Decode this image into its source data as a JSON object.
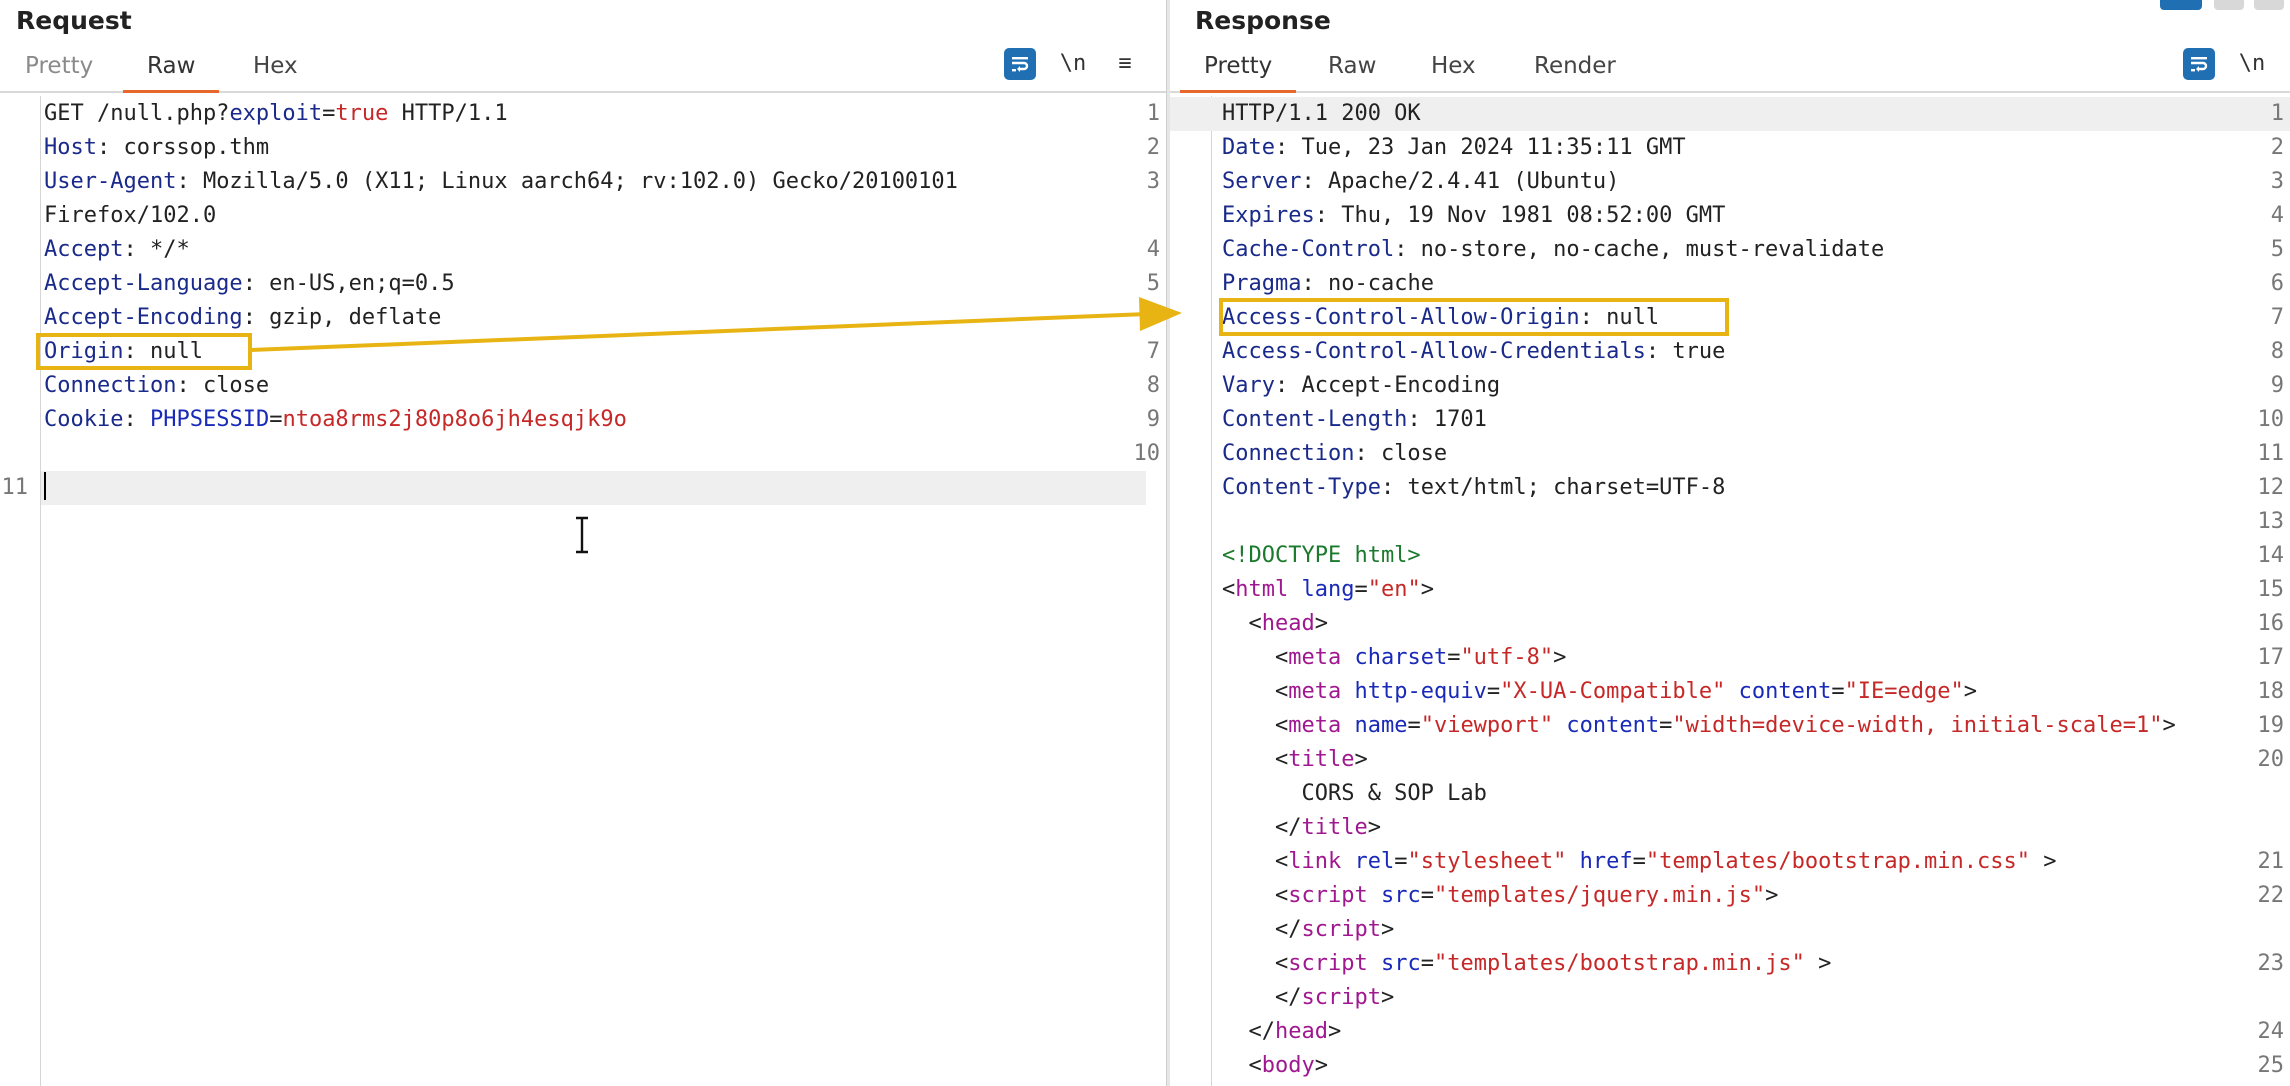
{
  "request": {
    "title": "Request",
    "tabs": [
      {
        "label": "Pretty",
        "active": false
      },
      {
        "label": "Raw",
        "active": true
      },
      {
        "label": "Hex",
        "active": false
      }
    ],
    "newline_btn": "\\n",
    "menu_btn": "≡",
    "lines": [
      {
        "n": "1",
        "t": [
          [
            "GET /null.php?",
            "v"
          ],
          [
            "exploit",
            "k"
          ],
          [
            "=",
            "v"
          ],
          [
            "true",
            "r"
          ],
          [
            " HTTP/1.1",
            "v"
          ]
        ]
      },
      {
        "n": "2",
        "t": [
          [
            "Host",
            "k"
          ],
          [
            ": corssop.thm",
            "v"
          ]
        ]
      },
      {
        "n": "3",
        "t": [
          [
            "User-Agent",
            "k"
          ],
          [
            ": Mozilla/5.0 (X11; Linux aarch64; rv:102.0) Gecko/20100101",
            "v"
          ]
        ]
      },
      {
        "n": "",
        "t": [
          [
            "Firefox/102.0",
            "v"
          ]
        ]
      },
      {
        "n": "4",
        "t": [
          [
            "Accept",
            "k"
          ],
          [
            ": */*",
            "v"
          ]
        ]
      },
      {
        "n": "5",
        "t": [
          [
            "Accept-Language",
            "k"
          ],
          [
            ": en-US,en;q=0.5",
            "v"
          ]
        ]
      },
      {
        "n": "6",
        "t": [
          [
            "Accept-Encoding",
            "k"
          ],
          [
            ": gzip, deflate",
            "v"
          ]
        ]
      },
      {
        "n": "7",
        "t": [
          [
            "Origin",
            "k"
          ],
          [
            ": null",
            "v"
          ]
        ]
      },
      {
        "n": "8",
        "t": [
          [
            "Connection",
            "k"
          ],
          [
            ": close",
            "v"
          ]
        ]
      },
      {
        "n": "9",
        "t": [
          [
            "Cookie",
            "k"
          ],
          [
            ": ",
            "v"
          ],
          [
            "PHPSESSID",
            "b"
          ],
          [
            "=",
            "v"
          ],
          [
            "ntoa8rms2j80p8o6jh4esqjk9o",
            "r"
          ]
        ]
      },
      {
        "n": "10",
        "t": []
      },
      {
        "n": "11",
        "t": [],
        "highlight": true
      }
    ]
  },
  "response": {
    "title": "Response",
    "tabs": [
      {
        "label": "Pretty",
        "active": true
      },
      {
        "label": "Raw",
        "active": false
      },
      {
        "label": "Hex",
        "active": false
      },
      {
        "label": "Render",
        "active": false
      }
    ],
    "newline_btn": "\\n",
    "lines": [
      {
        "n": "1",
        "t": [
          [
            "HTTP/1.1 200 OK",
            "v"
          ]
        ],
        "highlight": true
      },
      {
        "n": "2",
        "t": [
          [
            "Date",
            "k"
          ],
          [
            ": Tue, 23 Jan 2024 11:35:11 GMT",
            "v"
          ]
        ]
      },
      {
        "n": "3",
        "t": [
          [
            "Server",
            "k"
          ],
          [
            ": Apache/2.4.41 (Ubuntu)",
            "v"
          ]
        ]
      },
      {
        "n": "4",
        "t": [
          [
            "Expires",
            "k"
          ],
          [
            ": Thu, 19 Nov 1981 08:52:00 GMT",
            "v"
          ]
        ]
      },
      {
        "n": "5",
        "t": [
          [
            "Cache-Control",
            "k"
          ],
          [
            ": no-store, no-cache, must-revalidate",
            "v"
          ]
        ]
      },
      {
        "n": "6",
        "t": [
          [
            "Pragma",
            "k"
          ],
          [
            ": no-cache",
            "v"
          ]
        ]
      },
      {
        "n": "7",
        "t": [
          [
            "Access-Control-Allow-Origin",
            "k"
          ],
          [
            ": null",
            "v"
          ]
        ]
      },
      {
        "n": "8",
        "t": [
          [
            "Access-Control-Allow-Credentials",
            "k"
          ],
          [
            ": true",
            "v"
          ]
        ]
      },
      {
        "n": "9",
        "t": [
          [
            "Vary",
            "k"
          ],
          [
            ": Accept-Encoding",
            "v"
          ]
        ]
      },
      {
        "n": "10",
        "t": [
          [
            "Content-Length",
            "k"
          ],
          [
            ": 1701",
            "v"
          ]
        ]
      },
      {
        "n": "11",
        "t": [
          [
            "Connection",
            "k"
          ],
          [
            ": close",
            "v"
          ]
        ]
      },
      {
        "n": "12",
        "t": [
          [
            "Content-Type",
            "k"
          ],
          [
            ": text/html; charset=UTF-8",
            "v"
          ]
        ]
      },
      {
        "n": "13",
        "t": []
      },
      {
        "n": "14",
        "t": [
          [
            "<!DOCTYPE html>",
            "g"
          ]
        ]
      },
      {
        "n": "15",
        "t": [
          [
            "<",
            "p"
          ],
          [
            "html",
            "m"
          ],
          [
            " ",
            "p"
          ],
          [
            "lang",
            "b"
          ],
          [
            "=",
            "p"
          ],
          [
            "\"en\"",
            "r"
          ],
          [
            ">",
            "p"
          ]
        ]
      },
      {
        "n": "16",
        "t": [
          [
            "  <",
            "p"
          ],
          [
            "head",
            "m"
          ],
          [
            ">",
            "p"
          ]
        ]
      },
      {
        "n": "17",
        "t": [
          [
            "    <",
            "p"
          ],
          [
            "meta",
            "m"
          ],
          [
            " ",
            "p"
          ],
          [
            "charset",
            "b"
          ],
          [
            "=",
            "p"
          ],
          [
            "\"utf-8\"",
            "r"
          ],
          [
            ">",
            "p"
          ]
        ]
      },
      {
        "n": "18",
        "t": [
          [
            "    <",
            "p"
          ],
          [
            "meta",
            "m"
          ],
          [
            " ",
            "p"
          ],
          [
            "http-equiv",
            "b"
          ],
          [
            "=",
            "p"
          ],
          [
            "\"X-UA-Compatible\"",
            "r"
          ],
          [
            " ",
            "p"
          ],
          [
            "content",
            "b"
          ],
          [
            "=",
            "p"
          ],
          [
            "\"IE=edge\"",
            "r"
          ],
          [
            ">",
            "p"
          ]
        ]
      },
      {
        "n": "19",
        "t": [
          [
            "    <",
            "p"
          ],
          [
            "meta",
            "m"
          ],
          [
            " ",
            "p"
          ],
          [
            "name",
            "b"
          ],
          [
            "=",
            "p"
          ],
          [
            "\"viewport\"",
            "r"
          ],
          [
            " ",
            "p"
          ],
          [
            "content",
            "b"
          ],
          [
            "=",
            "p"
          ],
          [
            "\"width=device-width, initial-scale=1\"",
            "r"
          ],
          [
            ">",
            "p"
          ]
        ]
      },
      {
        "n": "20",
        "t": [
          [
            "    <",
            "p"
          ],
          [
            "title",
            "m"
          ],
          [
            ">",
            "p"
          ]
        ]
      },
      {
        "n": "",
        "t": [
          [
            "      CORS & SOP Lab",
            "v"
          ]
        ]
      },
      {
        "n": "",
        "t": [
          [
            "    </",
            "p"
          ],
          [
            "title",
            "m"
          ],
          [
            ">",
            "p"
          ]
        ]
      },
      {
        "n": "21",
        "t": [
          [
            "    <",
            "p"
          ],
          [
            "link",
            "m"
          ],
          [
            " ",
            "p"
          ],
          [
            "rel",
            "b"
          ],
          [
            "=",
            "p"
          ],
          [
            "\"stylesheet\"",
            "r"
          ],
          [
            " ",
            "p"
          ],
          [
            "href",
            "b"
          ],
          [
            "=",
            "p"
          ],
          [
            "\"templates/bootstrap.min.css\"",
            "r"
          ],
          [
            " >",
            "p"
          ]
        ]
      },
      {
        "n": "22",
        "t": [
          [
            "    <",
            "p"
          ],
          [
            "script",
            "m"
          ],
          [
            " ",
            "p"
          ],
          [
            "src",
            "b"
          ],
          [
            "=",
            "p"
          ],
          [
            "\"templates/jquery.min.js\"",
            "r"
          ],
          [
            ">",
            "p"
          ]
        ]
      },
      {
        "n": "",
        "t": [
          [
            "    </",
            "p"
          ],
          [
            "script",
            "m"
          ],
          [
            ">",
            "p"
          ]
        ]
      },
      {
        "n": "23",
        "t": [
          [
            "    <",
            "p"
          ],
          [
            "script",
            "m"
          ],
          [
            " ",
            "p"
          ],
          [
            "src",
            "b"
          ],
          [
            "=",
            "p"
          ],
          [
            "\"templates/bootstrap.min.js\"",
            "r"
          ],
          [
            " >",
            "p"
          ]
        ]
      },
      {
        "n": "",
        "t": [
          [
            "    </",
            "p"
          ],
          [
            "script",
            "m"
          ],
          [
            ">",
            "p"
          ]
        ]
      },
      {
        "n": "24",
        "t": [
          [
            "  </",
            "p"
          ],
          [
            "head",
            "m"
          ],
          [
            ">",
            "p"
          ]
        ]
      },
      {
        "n": "25",
        "t": [
          [
            "  <",
            "p"
          ],
          [
            "body",
            "m"
          ],
          [
            ">",
            "p"
          ]
        ]
      }
    ]
  },
  "colors": {
    "accent_tab": "#e8672c",
    "callout": "#e8b414",
    "wrap_button": "#1f6fb2"
  }
}
